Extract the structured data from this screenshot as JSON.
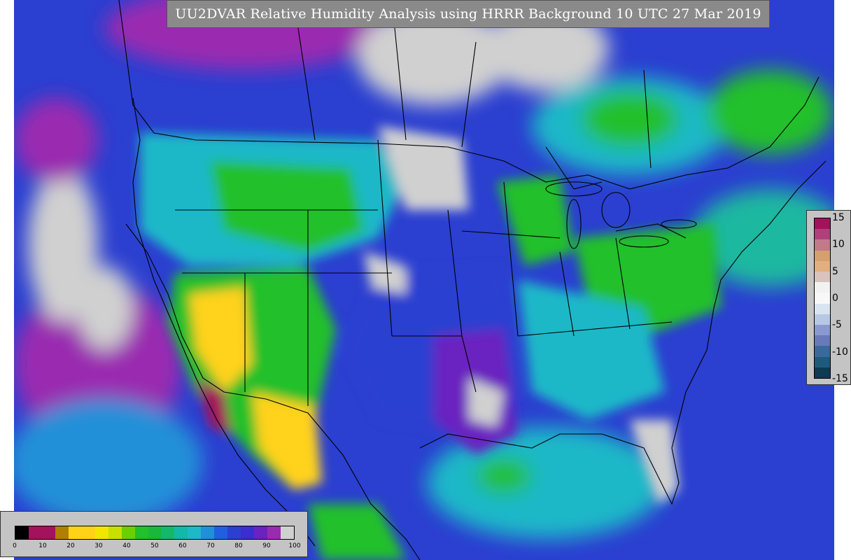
{
  "title": "UU2DVAR Relative Humidity Analysis using HRRR Background 10 UTC 27 Mar 2019",
  "map": {
    "field": "relative-humidity",
    "colors": {
      "ocean": "#2b3fd0",
      "dry_yellow": "#ffd21a",
      "green": "#22c02a",
      "cyan": "#1eb8c8",
      "purple": "#8a1fb0",
      "moist_white": "#d4d4d4",
      "magenta": "#a3125a",
      "boundaries": "#000000"
    }
  },
  "rh_legend": {
    "ticks": [
      "0",
      "10",
      "20",
      "30",
      "40",
      "50",
      "60",
      "70",
      "80",
      "90",
      "100"
    ],
    "colors": [
      "#000000",
      "#a3125a",
      "#a3125a",
      "#b08000",
      "#ffd21a",
      "#ffd21a",
      "#f3e500",
      "#c8e000",
      "#6ad000",
      "#22c02a",
      "#19b83a",
      "#14b86c",
      "#12b8a8",
      "#1eb8c8",
      "#2090d8",
      "#2060e0",
      "#2b3fd0",
      "#3a2ed0",
      "#6a22c0",
      "#9a2ab0",
      "#d0d0d0"
    ]
  },
  "increment_legend": {
    "ticks": [
      "15",
      "10",
      "5",
      "0",
      "-5",
      "-10",
      "-15"
    ],
    "colors": [
      "#a3125a",
      "#b0407a",
      "#c07a8a",
      "#d4a070",
      "#e0b080",
      "#d8c4bc",
      "#f2f2f2",
      "#f8f8f8",
      "#d8e4ef",
      "#b8c8e4",
      "#8a9ad0",
      "#6a7ab8",
      "#3a6a9a",
      "#1f5a7a",
      "#0e3a52"
    ]
  }
}
